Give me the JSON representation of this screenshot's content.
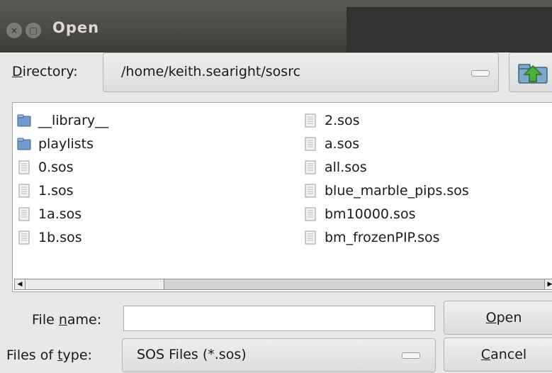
{
  "window": {
    "title": "Open",
    "close_glyph": "×",
    "maximize_glyph": "□"
  },
  "directory": {
    "label_mnemonic": "D",
    "label_rest": "irectory:",
    "value": "/home/keith.searight/sosrc"
  },
  "files": {
    "column1": [
      {
        "name": "__library__",
        "icon": "folder-icon"
      },
      {
        "name": "playlists",
        "icon": "folder-icon"
      },
      {
        "name": "0.sos",
        "icon": "file-icon"
      },
      {
        "name": "1.sos",
        "icon": "file-icon"
      },
      {
        "name": "1a.sos",
        "icon": "file-icon"
      },
      {
        "name": "1b.sos",
        "icon": "file-icon"
      }
    ],
    "column2": [
      {
        "name": "2.sos",
        "icon": "file-icon"
      },
      {
        "name": "a.sos",
        "icon": "file-icon"
      },
      {
        "name": "all.sos",
        "icon": "file-icon"
      },
      {
        "name": "blue_marble_pips.sos",
        "icon": "file-icon"
      },
      {
        "name": "bm10000.sos",
        "icon": "file-icon"
      },
      {
        "name": "bm_frozenPIP.sos",
        "icon": "file-icon"
      }
    ]
  },
  "filename": {
    "label_pre": "File ",
    "label_mnemonic": "n",
    "label_post": "ame:",
    "value": ""
  },
  "filetype": {
    "label_pre": "Files of ",
    "label_mnemonic": "t",
    "label_post": "ype:",
    "value": "SOS Files (*.sos)"
  },
  "buttons": {
    "open_mnemonic": "O",
    "open_rest": "pen",
    "cancel_mnemonic": "C",
    "cancel_rest": "ancel"
  },
  "colors": {
    "folder": "#6f9bd1",
    "accent_green": "#4caf3a"
  }
}
